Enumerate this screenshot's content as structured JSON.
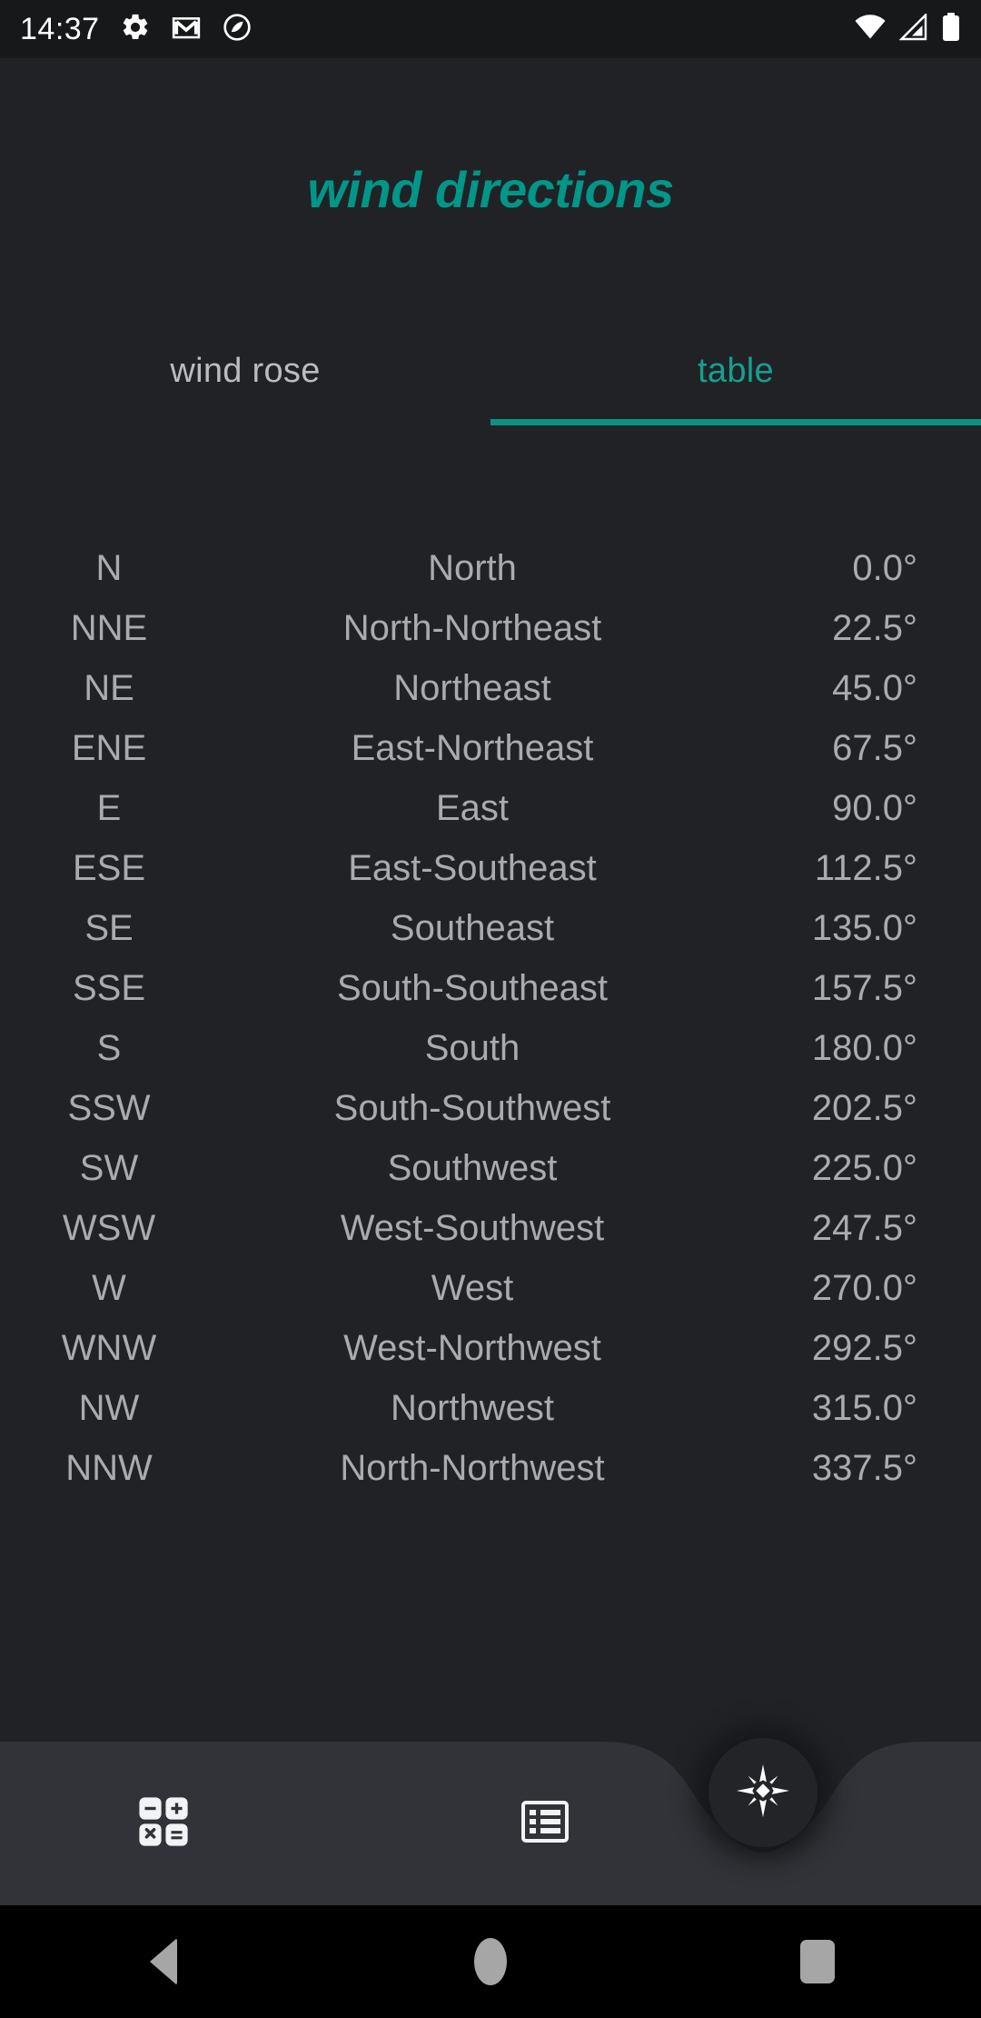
{
  "status_bar": {
    "time": "14:37",
    "left_icons": [
      "gear-icon",
      "gmail-icon",
      "adobe-circle-icon"
    ],
    "right_icons": [
      "wifi-icon",
      "cell-signal-icon",
      "battery-icon"
    ],
    "background_color": "#17181a"
  },
  "header": {
    "title": "wind directions",
    "accent_color": "#009688"
  },
  "tabs": [
    {
      "label": "wind rose",
      "active": false
    },
    {
      "label": "table",
      "active": true
    }
  ],
  "table": {
    "columns": [
      "abbreviation",
      "name",
      "degrees"
    ],
    "rows": [
      {
        "abbr": "N",
        "name": "North",
        "deg": "0.0°"
      },
      {
        "abbr": "NNE",
        "name": "North-Northeast",
        "deg": "22.5°"
      },
      {
        "abbr": "NE",
        "name": "Northeast",
        "deg": "45.0°"
      },
      {
        "abbr": "ENE",
        "name": "East-Northeast",
        "deg": "67.5°"
      },
      {
        "abbr": "E",
        "name": "East",
        "deg": "90.0°"
      },
      {
        "abbr": "ESE",
        "name": "East-Southeast",
        "deg": "112.5°"
      },
      {
        "abbr": "SE",
        "name": "Southeast",
        "deg": "135.0°"
      },
      {
        "abbr": "SSE",
        "name": "South-Southeast",
        "deg": "157.5°"
      },
      {
        "abbr": "S",
        "name": "South",
        "deg": "180.0°"
      },
      {
        "abbr": "SSW",
        "name": "South-Southwest",
        "deg": "202.5°"
      },
      {
        "abbr": "SW",
        "name": "Southwest",
        "deg": "225.0°"
      },
      {
        "abbr": "WSW",
        "name": "West-Southwest",
        "deg": "247.5°"
      },
      {
        "abbr": "W",
        "name": "West",
        "deg": "270.0°"
      },
      {
        "abbr": "WNW",
        "name": "West-Northwest",
        "deg": "292.5°"
      },
      {
        "abbr": "NW",
        "name": "Northwest",
        "deg": "315.0°"
      },
      {
        "abbr": "NNW",
        "name": "North-Northwest",
        "deg": "337.5°"
      }
    ]
  },
  "bottom_bar": {
    "background_color": "#313338",
    "items": [
      {
        "icon": "calculator-icon"
      },
      {
        "icon": "list-icon"
      }
    ],
    "fab": {
      "icon": "compass-rose-icon",
      "background_color": "#232427"
    }
  },
  "nav_bar": {
    "items": [
      "back-icon",
      "home-icon",
      "recents-icon"
    ],
    "background_color": "#000000"
  },
  "colors": {
    "page_background": "#212226",
    "text_primary": "#a8abaf",
    "accent": "#009688",
    "tab_inactive": "#b9bcc0"
  }
}
